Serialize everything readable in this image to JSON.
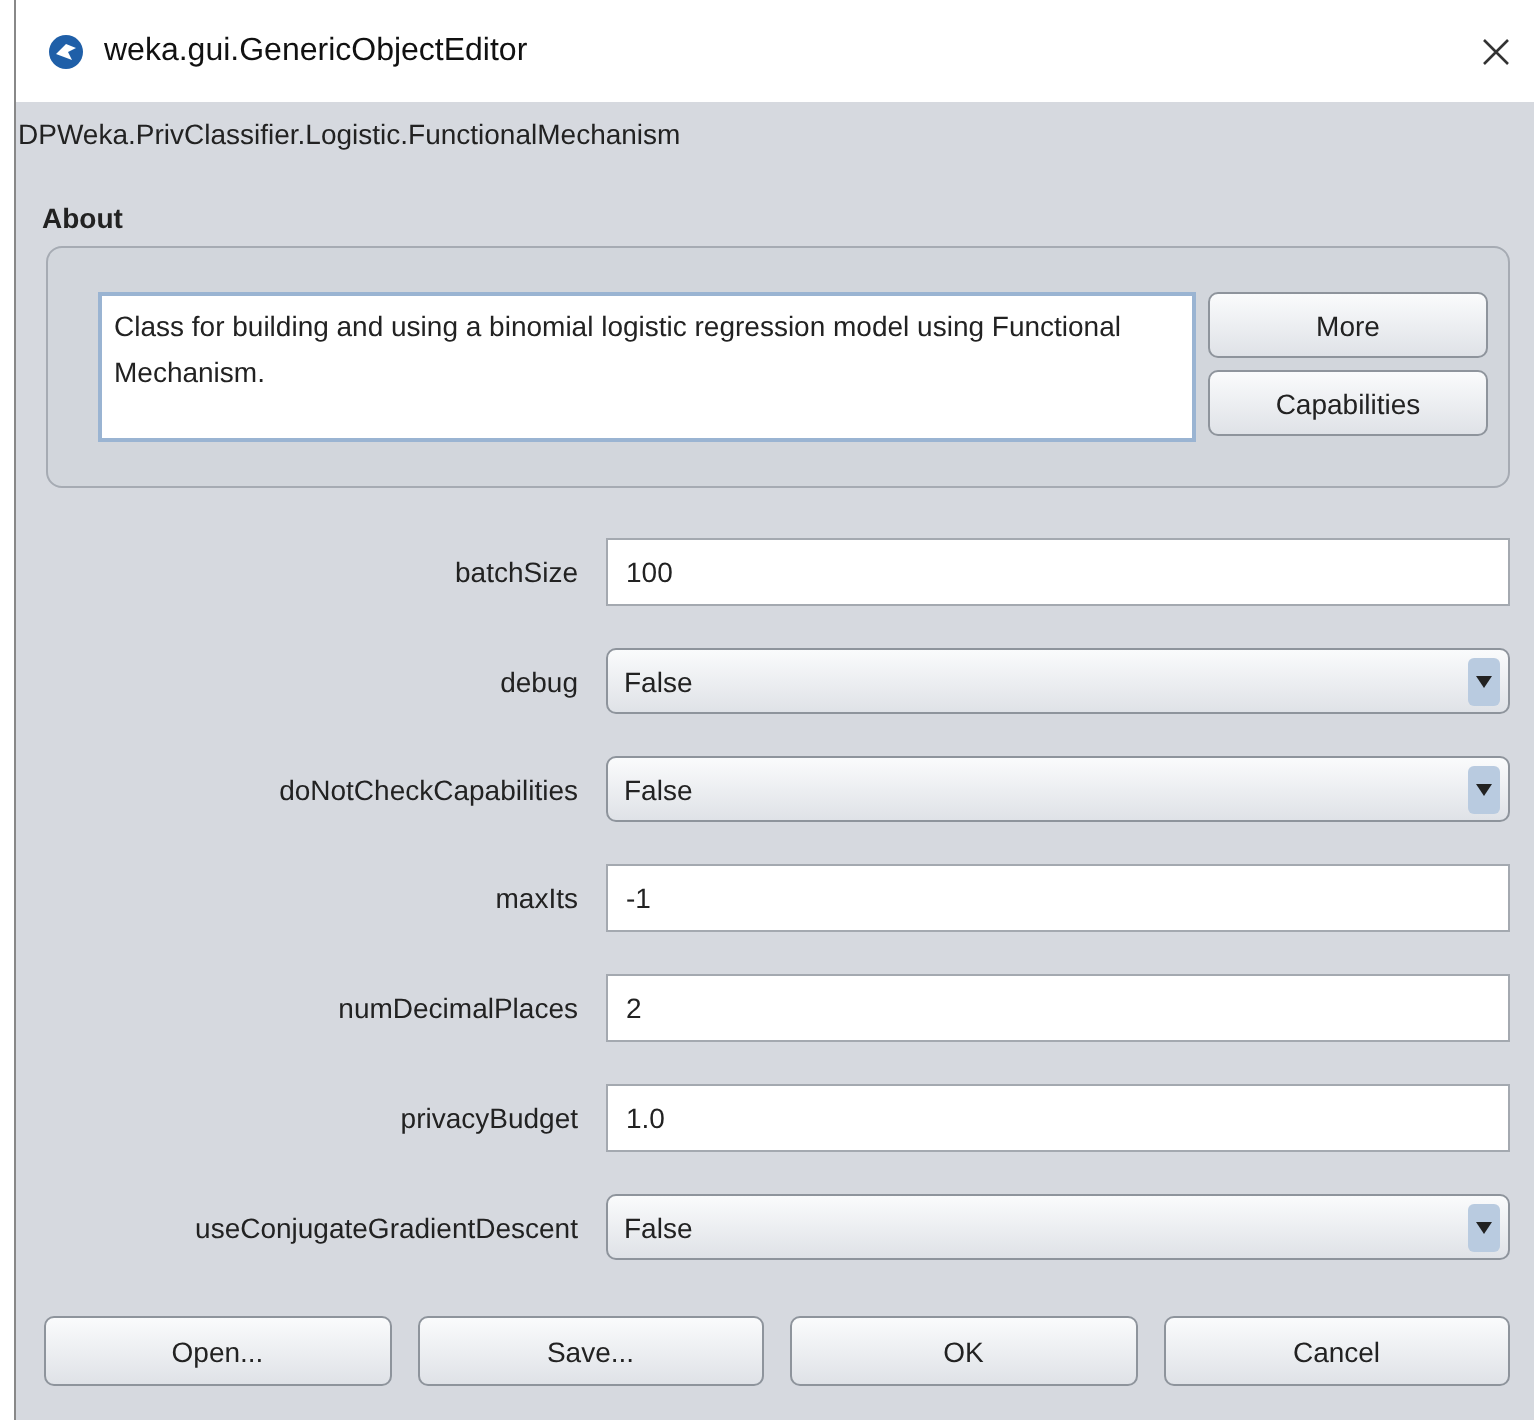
{
  "window": {
    "title": "weka.gui.GenericObjectEditor"
  },
  "class_name": "DPWeka.PrivClassifier.Logistic.FunctionalMechanism",
  "about": {
    "heading": "About",
    "text": "Class for building and using a binomial logistic regression model using Functional Mechanism.",
    "buttons": [
      "More",
      "Capabilities"
    ]
  },
  "properties": [
    {
      "label": "batchSize",
      "kind": "text",
      "value": "100"
    },
    {
      "label": "debug",
      "kind": "dropdown",
      "value": "False"
    },
    {
      "label": "doNotCheckCapabilities",
      "kind": "dropdown",
      "value": "False"
    },
    {
      "label": "maxIts",
      "kind": "text",
      "value": "-1"
    },
    {
      "label": "numDecimalPlaces",
      "kind": "text",
      "value": "2"
    },
    {
      "label": "privacyBudget",
      "kind": "text",
      "value": "1.0"
    },
    {
      "label": "useConjugateGradientDescent",
      "kind": "dropdown",
      "value": "False"
    }
  ],
  "buttons": [
    "Open...",
    "Save...",
    "OK",
    "Cancel"
  ]
}
